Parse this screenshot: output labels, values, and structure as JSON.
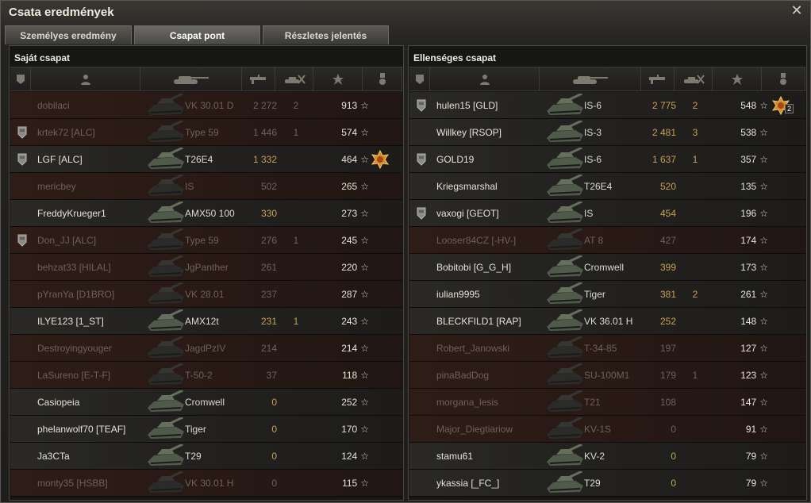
{
  "window": {
    "title": "Csata eredmények"
  },
  "tabs": [
    {
      "label": "Személyes eredmény",
      "active": false
    },
    {
      "label": "Csapat pont",
      "active": true
    },
    {
      "label": "Részletes jelentés",
      "active": false
    }
  ],
  "columns": [
    "platoon-icon",
    "player-icon",
    "tank-icon",
    "damage-icon",
    "frags-icon",
    "xp-icon",
    "medal-icon"
  ],
  "left": {
    "title": "Saját csapat",
    "rows": [
      {
        "name": "dobilaci",
        "vehicle": "VK 30.01 D",
        "damage": "2 272",
        "frags": "2",
        "xp": "913",
        "dead": true,
        "platoon": false,
        "medal": false
      },
      {
        "name": "krtek72 [ALC]",
        "vehicle": "Type 59",
        "damage": "1 446",
        "frags": "1",
        "xp": "574",
        "dead": true,
        "platoon": true,
        "medal": false
      },
      {
        "name": "LGF [ALC]",
        "vehicle": "T26E4",
        "damage": "1 332",
        "frags": "",
        "xp": "464",
        "dead": false,
        "platoon": true,
        "medal": true
      },
      {
        "name": "mericbey",
        "vehicle": "IS",
        "damage": "502",
        "frags": "",
        "xp": "265",
        "dead": true,
        "platoon": false,
        "medal": false
      },
      {
        "name": "FreddyKrueger1",
        "vehicle": "AMX50 100",
        "damage": "330",
        "frags": "",
        "xp": "273",
        "dead": false,
        "platoon": false,
        "medal": false
      },
      {
        "name": "Don_JJ [ALC]",
        "vehicle": "Type 59",
        "damage": "276",
        "frags": "1",
        "xp": "245",
        "dead": true,
        "platoon": true,
        "medal": false
      },
      {
        "name": "behzat33 [HILAL]",
        "vehicle": "JgPanther",
        "damage": "261",
        "frags": "",
        "xp": "220",
        "dead": true,
        "platoon": false,
        "medal": false
      },
      {
        "name": "pYranYa [D1BRO]",
        "vehicle": "VK 28.01",
        "damage": "237",
        "frags": "",
        "xp": "287",
        "dead": true,
        "platoon": false,
        "medal": false
      },
      {
        "name": "ILYE123 [1_ST]",
        "vehicle": "AMX12t",
        "damage": "231",
        "frags": "1",
        "xp": "243",
        "dead": false,
        "platoon": false,
        "medal": false
      },
      {
        "name": "Destroyingyouger",
        "vehicle": "JagdPzIV",
        "damage": "214",
        "frags": "",
        "xp": "214",
        "dead": true,
        "platoon": false,
        "medal": false
      },
      {
        "name": "LaSureno [E-T-F]",
        "vehicle": "T-50-2",
        "damage": "37",
        "frags": "",
        "xp": "118",
        "dead": true,
        "platoon": false,
        "medal": false
      },
      {
        "name": "Casiopeia",
        "vehicle": "Cromwell",
        "damage": "0",
        "frags": "",
        "xp": "252",
        "dead": false,
        "platoon": false,
        "medal": false
      },
      {
        "name": "phelanwolf70 [TEAF]",
        "vehicle": "Tiger",
        "damage": "0",
        "frags": "",
        "xp": "170",
        "dead": false,
        "platoon": false,
        "medal": false
      },
      {
        "name": "Ja3CTa",
        "vehicle": "T29",
        "damage": "0",
        "frags": "",
        "xp": "124",
        "dead": false,
        "platoon": false,
        "medal": false
      },
      {
        "name": "monty35 [HSBB]",
        "vehicle": "VK 30.01 H",
        "damage": "0",
        "frags": "",
        "xp": "115",
        "dead": true,
        "platoon": false,
        "medal": false
      }
    ]
  },
  "right": {
    "title": "Ellenséges csapat",
    "rows": [
      {
        "name": "hulen15 [GLD]",
        "vehicle": "IS-6",
        "damage": "2 775",
        "frags": "2",
        "xp": "548",
        "dead": false,
        "platoon": true,
        "medal": true,
        "medal_count": "2"
      },
      {
        "name": "Willkey [RSOP]",
        "vehicle": "IS-3",
        "damage": "2 481",
        "frags": "3",
        "xp": "538",
        "dead": false,
        "platoon": false,
        "medal": false
      },
      {
        "name": "GOLD19",
        "vehicle": "IS-6",
        "damage": "1 637",
        "frags": "1",
        "xp": "357",
        "dead": false,
        "platoon": true,
        "medal": false
      },
      {
        "name": "Kriegsmarshal",
        "vehicle": "T26E4",
        "damage": "520",
        "frags": "",
        "xp": "135",
        "dead": false,
        "platoon": false,
        "medal": false
      },
      {
        "name": "vaxogi [GEOT]",
        "vehicle": "IS",
        "damage": "454",
        "frags": "",
        "xp": "196",
        "dead": false,
        "platoon": true,
        "medal": false
      },
      {
        "name": "Looser84CZ [-HV-]",
        "vehicle": "AT 8",
        "damage": "427",
        "frags": "",
        "xp": "174",
        "dead": true,
        "platoon": false,
        "medal": false
      },
      {
        "name": "Bobitobi [G_G_H]",
        "vehicle": "Cromwell",
        "damage": "399",
        "frags": "",
        "xp": "173",
        "dead": false,
        "platoon": false,
        "medal": false
      },
      {
        "name": "iulian9995",
        "vehicle": "Tiger",
        "damage": "381",
        "frags": "2",
        "xp": "261",
        "dead": false,
        "platoon": false,
        "medal": false
      },
      {
        "name": "BLECKFILD1 [RAP]",
        "vehicle": "VK 36.01 H",
        "damage": "252",
        "frags": "",
        "xp": "148",
        "dead": false,
        "platoon": false,
        "medal": false
      },
      {
        "name": "Robert_Janowski",
        "vehicle": "T-34-85",
        "damage": "197",
        "frags": "",
        "xp": "127",
        "dead": true,
        "platoon": false,
        "medal": false
      },
      {
        "name": "pinaBadDog",
        "vehicle": "SU-100M1",
        "damage": "179",
        "frags": "1",
        "xp": "123",
        "dead": true,
        "platoon": false,
        "medal": false
      },
      {
        "name": "morgana_lesis",
        "vehicle": "T21",
        "damage": "108",
        "frags": "",
        "xp": "147",
        "dead": true,
        "platoon": false,
        "medal": false
      },
      {
        "name": "Major_Diegtiariow",
        "vehicle": "KV-1S",
        "damage": "0",
        "frags": "",
        "xp": "91",
        "dead": true,
        "platoon": false,
        "medal": false
      },
      {
        "name": "stamu61",
        "vehicle": "KV-2",
        "damage": "0",
        "frags": "",
        "xp": "79",
        "dead": false,
        "platoon": false,
        "medal": false
      },
      {
        "name": "ykassia [_FC_]",
        "vehicle": "T29",
        "damage": "0",
        "frags": "",
        "xp": "79",
        "dead": false,
        "platoon": false,
        "medal": false
      }
    ]
  },
  "colors": {
    "accent": "#c9a24f",
    "dead_row": "#2e1d16",
    "alive_row": "#2a2926"
  }
}
